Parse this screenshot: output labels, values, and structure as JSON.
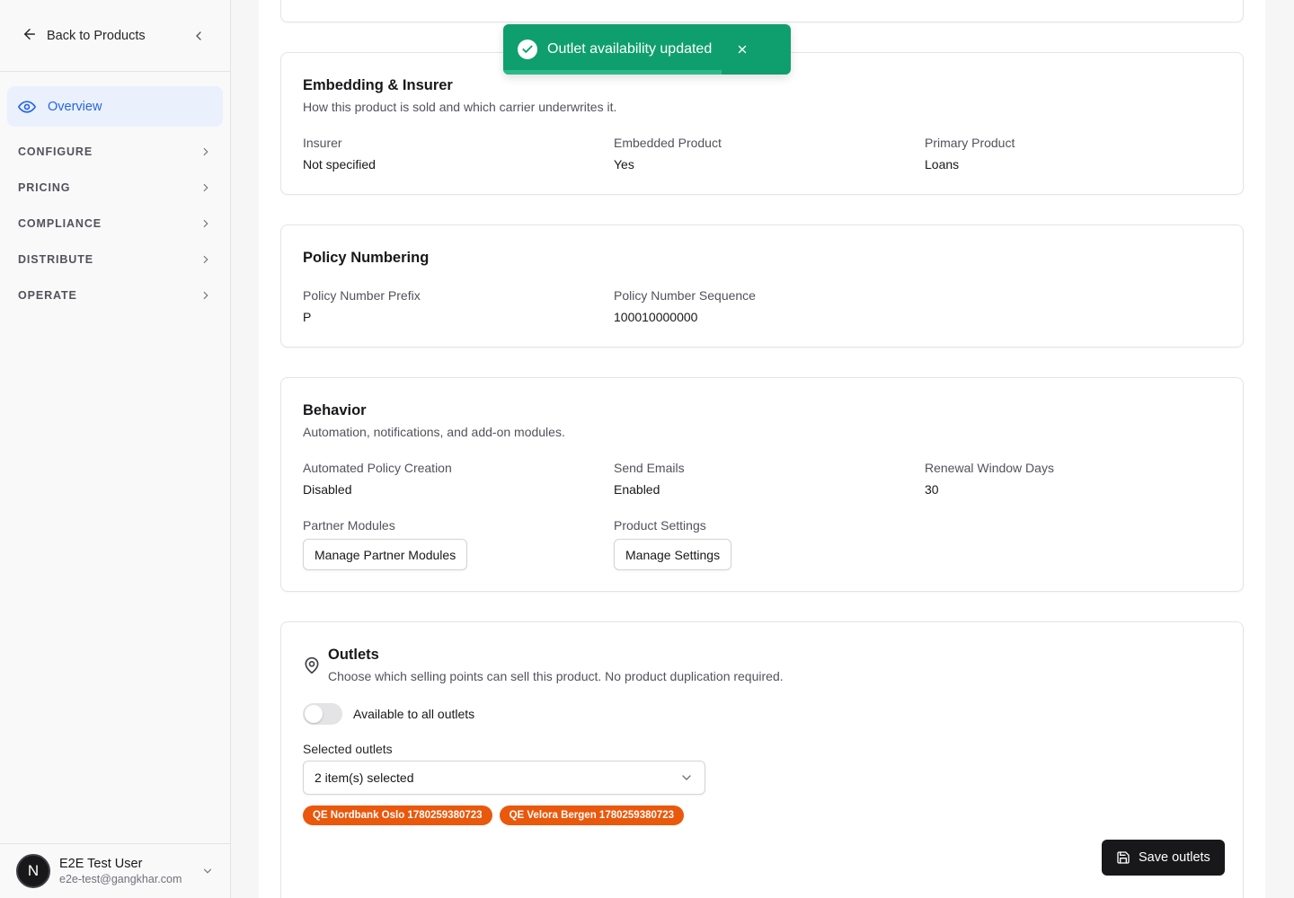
{
  "sidebar": {
    "back_label": "Back to Products",
    "active_item": "Overview",
    "groups": [
      "CONFIGURE",
      "PRICING",
      "COMPLIANCE",
      "DISTRIBUTE",
      "OPERATE"
    ],
    "user": {
      "initial": "N",
      "name": "E2E Test User",
      "email": "e2e-test@gangkhar.com"
    }
  },
  "toast": {
    "message": "Outlet availability updated",
    "progress": 0.76,
    "color": "#0f9f6e"
  },
  "embedding": {
    "title": "Embedding & Insurer",
    "subtitle": "How this product is sold and which carrier underwrites it.",
    "fields": [
      {
        "label": "Insurer",
        "value": "Not specified"
      },
      {
        "label": "Embedded Product",
        "value": "Yes"
      },
      {
        "label": "Primary Product",
        "value": "Loans"
      }
    ]
  },
  "numbering": {
    "title": "Policy Numbering",
    "fields": [
      {
        "label": "Policy Number Prefix",
        "value": "P"
      },
      {
        "label": "Policy Number Sequence",
        "value": "100010000000"
      }
    ]
  },
  "behavior": {
    "title": "Behavior",
    "subtitle": "Automation, notifications, and add-on modules.",
    "fields": [
      {
        "label": "Automated Policy Creation",
        "value": "Disabled"
      },
      {
        "label": "Send Emails",
        "value": "Enabled"
      },
      {
        "label": "Renewal Window Days",
        "value": "30"
      }
    ],
    "partner_modules": {
      "label": "Partner Modules",
      "button": "Manage Partner Modules"
    },
    "product_settings": {
      "label": "Product Settings",
      "button": "Manage Settings"
    }
  },
  "outlets": {
    "title": "Outlets",
    "subtitle": "Choose which selling points can sell this product. No product duplication required.",
    "toggle_label": "Available to all outlets",
    "toggle_on": false,
    "selected_label": "Selected outlets",
    "select_value": "2 item(s) selected",
    "chips": [
      "QE Nordbank Oslo 1780259380723",
      "QE Velora Bergen 1780259380723"
    ],
    "chip_color": "#ea580c",
    "save_button": "Save outlets"
  }
}
